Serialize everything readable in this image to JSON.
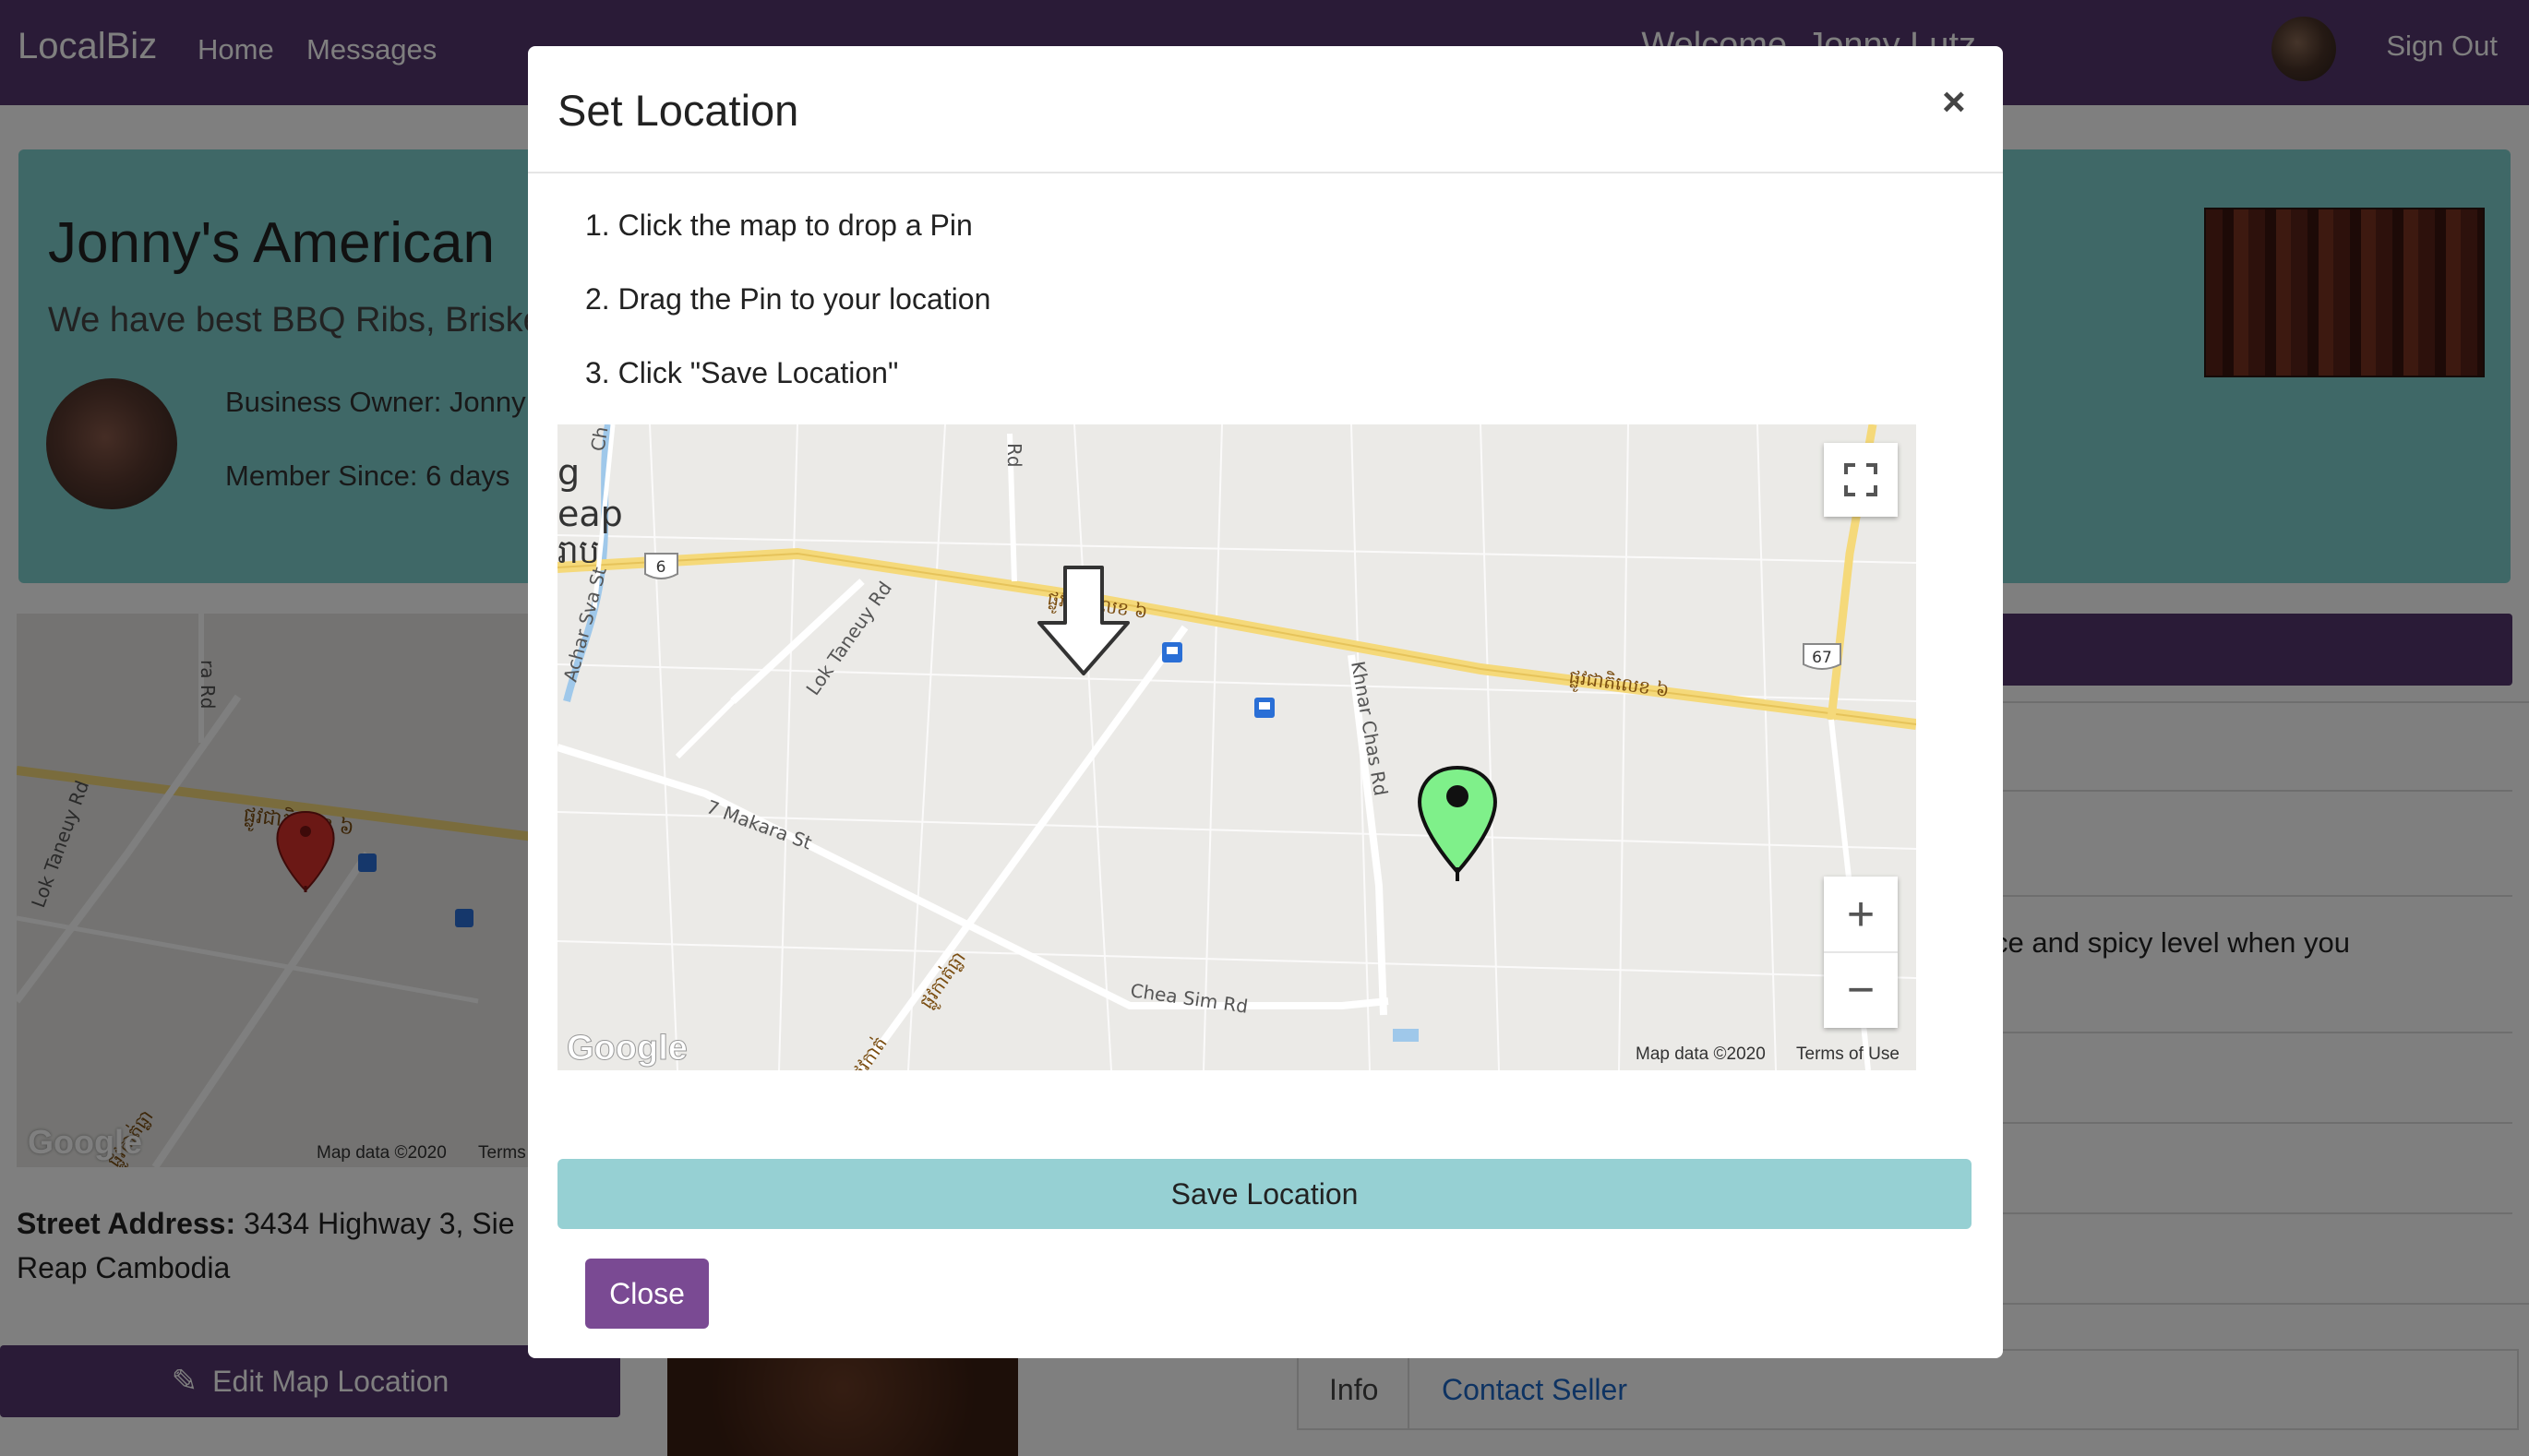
{
  "navbar": {
    "brand": "LocalBiz",
    "links": [
      "Home",
      "Messages"
    ],
    "welcome": "Welcome, Jonny Lutz",
    "signout": "Sign Out"
  },
  "hero": {
    "title": "Jonny's American",
    "subtitle": "We have best BBQ Ribs, Briske",
    "owner": "Business Owner: Jonny",
    "member_since": "Member Since: 6 days"
  },
  "left_map": {
    "road_label": "ផ្លូវជាតិលេខ ៦",
    "road_label_2": "Lok Taneuy Rd",
    "road_label_3": "ra Rd",
    "road_label_4": "ផ្លូវកាត់ធ្លា",
    "attribution": "Map data ©2020",
    "terms": "Terms",
    "google": "Google"
  },
  "street": {
    "label": "Street Address:",
    "value": "3434 Highway 3, Sie",
    "value2": "Reap Cambodia"
  },
  "edit_button": "Edit Map Location",
  "right": {
    "snippet": "ce and spicy level when you",
    "tab_info": "Info",
    "tab_contact": "Contact Seller"
  },
  "modal": {
    "title": "Set Location",
    "close_x": "×",
    "steps": [
      "1. Click the map to drop a Pin",
      "2. Drag the Pin to your location",
      "3. Click \"Save Location\""
    ],
    "map": {
      "labels": {
        "highway_6": "6",
        "highway_67": "67",
        "road_kh_1": "ផ្លូវជាតិលេខ ៦",
        "road_kh_2": "ផ្លូវជាតិលេខ ៦",
        "lok_taneuy": "Lok Taneuy Rd",
        "achar_sva": "Achar Sva St",
        "makara": "7 Makara St",
        "khnar_chas": "Khnar Chas Rd",
        "chea_sim": "Chea Sim Rd",
        "rd": "Rd",
        "ch": "Ch",
        "g": "g",
        "eap": "eap",
        "kh_city": "រាប",
        "kh_road_3": "ផ្លូវកាត់ធ្លា",
        "kh_road_4": "ផ្លូវកាត់"
      },
      "attribution": "Map data ©2020",
      "terms": "Terms of Use",
      "google": "Google",
      "zoom_in": "+",
      "zoom_out": "−"
    },
    "save_button": "Save Location",
    "close_button": "Close"
  },
  "colors": {
    "navbar": "#54366f",
    "hero": "#7fd0cf",
    "save": "#96d0d3",
    "close": "#7a4a93",
    "pin_green": "#7ff08a",
    "pin_red": "#d6302a"
  }
}
